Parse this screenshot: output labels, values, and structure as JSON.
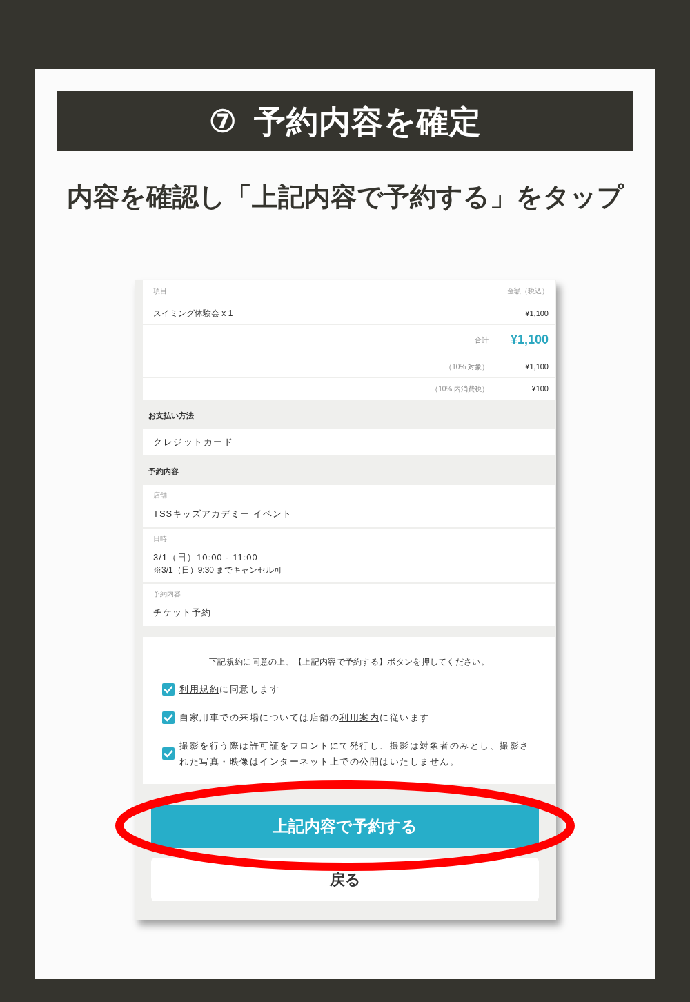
{
  "page": {
    "step": "⑦",
    "title": "予約内容を確定",
    "instruction": "内容を確認し「上記内容で予約する」をタップ"
  },
  "screen": {
    "table": {
      "columns": [
        "項目",
        "金額（税込）"
      ],
      "rows": [
        {
          "kind": "item",
          "label": "スイミング体験会 x 1",
          "amount": "¥1,100"
        },
        {
          "kind": "total",
          "label": "合計",
          "amount": "¥1,100"
        },
        {
          "kind": "tax",
          "label": "（10% 対象）",
          "amount": "¥1,100"
        },
        {
          "kind": "tax",
          "label": "（10% 内消費税）",
          "amount": "¥100"
        }
      ]
    },
    "payment": {
      "heading": "お支払い方法",
      "value": "クレジットカード"
    },
    "reservation": {
      "heading": "予約内容",
      "fields": [
        {
          "label": "店舗",
          "value": "TSSキッズアカデミー イベント"
        },
        {
          "label": "日時",
          "value": "3/1（日）10:00 - 11:00",
          "note": "※3/1（日）9:30 までキャンセル可"
        },
        {
          "label": "予約内容",
          "value": "チケット予約"
        }
      ]
    },
    "agreement": {
      "instruction": "下記規約に同意の上、【上記内容で予約する】ボタンを押してください。",
      "checkboxes": [
        {
          "checked": true,
          "parts": [
            {
              "kind": "link",
              "text": "利用規約"
            },
            {
              "kind": "text",
              "text": "に同意します"
            }
          ]
        },
        {
          "checked": true,
          "parts": [
            {
              "kind": "text",
              "text": "自家用車での来場については店舗の"
            },
            {
              "kind": "link",
              "text": "利用案内"
            },
            {
              "kind": "text",
              "text": "に従います"
            }
          ]
        },
        {
          "checked": true,
          "parts": [
            {
              "kind": "text",
              "text": "撮影を行う際は許可証をフロントにて発行し、撮影は対象者のみとし、撮影された写真・映像はインターネット上での公開はいたしません。"
            }
          ]
        }
      ]
    },
    "buttons": [
      {
        "kind": "primary",
        "label": "上記内容で予約する"
      },
      {
        "kind": "secondary",
        "label": "戻る"
      }
    ]
  },
  "highlight": {
    "kind": "ellipse"
  }
}
